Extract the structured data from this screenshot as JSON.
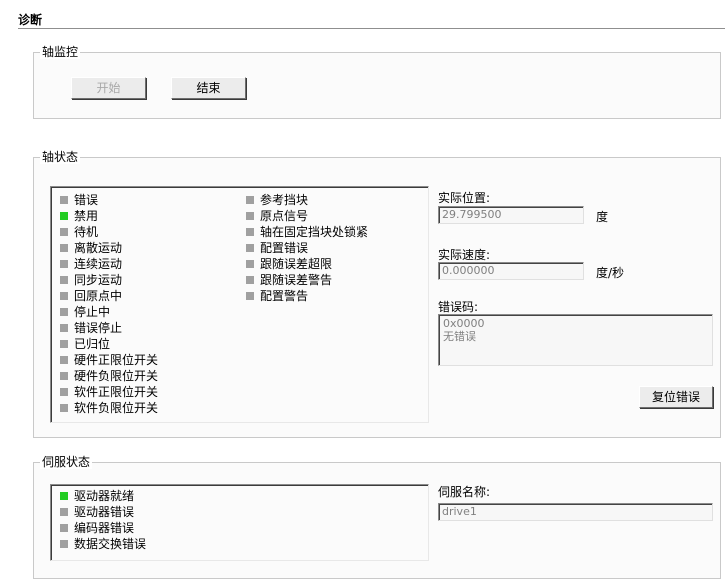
{
  "page_title": "诊断",
  "axis_monitor": {
    "legend": "轴监控",
    "start_label": "开始",
    "end_label": "结束"
  },
  "axis_status": {
    "legend": "轴状态",
    "left_items": [
      {
        "label": "错误",
        "color": "#a0a0a0"
      },
      {
        "label": "禁用",
        "color": "#22cc22"
      },
      {
        "label": "待机",
        "color": "#a0a0a0"
      },
      {
        "label": "离散运动",
        "color": "#a0a0a0"
      },
      {
        "label": "连续运动",
        "color": "#a0a0a0"
      },
      {
        "label": "同步运动",
        "color": "#a0a0a0"
      },
      {
        "label": "回原点中",
        "color": "#a0a0a0"
      },
      {
        "label": "停止中",
        "color": "#a0a0a0"
      },
      {
        "label": "错误停止",
        "color": "#a0a0a0"
      },
      {
        "label": "已归位",
        "color": "#a0a0a0"
      },
      {
        "label": "硬件正限位开关",
        "color": "#a0a0a0"
      },
      {
        "label": "硬件负限位开关",
        "color": "#a0a0a0"
      },
      {
        "label": "软件正限位开关",
        "color": "#a0a0a0"
      },
      {
        "label": "软件负限位开关",
        "color": "#a0a0a0"
      }
    ],
    "right_items": [
      {
        "label": "参考挡块",
        "color": "#a0a0a0"
      },
      {
        "label": "原点信号",
        "color": "#a0a0a0"
      },
      {
        "label": "轴在固定挡块处锁紧",
        "color": "#a0a0a0"
      },
      {
        "label": "配置错误",
        "color": "#a0a0a0"
      },
      {
        "label": "跟随误差超限",
        "color": "#a0a0a0"
      },
      {
        "label": "跟随误差警告",
        "color": "#a0a0a0"
      },
      {
        "label": "配置警告",
        "color": "#a0a0a0"
      }
    ],
    "actual_position_label": "实际位置:",
    "actual_position_value": "29.799500",
    "actual_position_unit": "度",
    "actual_velocity_label": "实际速度:",
    "actual_velocity_value": "0.000000",
    "actual_velocity_unit": "度/秒",
    "error_code_label": "错误码:",
    "error_code_value": "0x0000",
    "error_code_text": "无错误",
    "reset_error_label": "复位错误"
  },
  "servo_status": {
    "legend": "伺服状态",
    "items": [
      {
        "label": "驱动器就绪",
        "color": "#22cc22"
      },
      {
        "label": "驱动器错误",
        "color": "#a0a0a0"
      },
      {
        "label": "编码器错误",
        "color": "#a0a0a0"
      },
      {
        "label": "数据交换错误",
        "color": "#a0a0a0"
      }
    ],
    "servo_name_label": "伺服名称:",
    "servo_name_value": "drive1"
  }
}
